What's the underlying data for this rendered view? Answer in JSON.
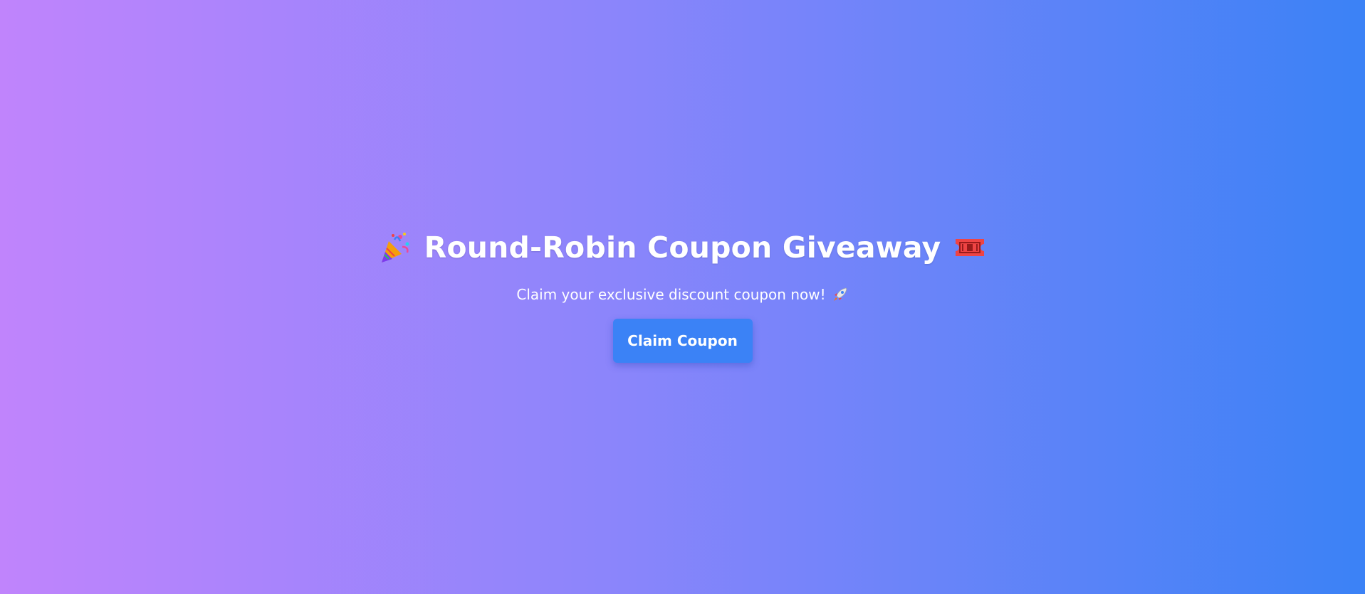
{
  "hero": {
    "title": "Round-Robin Coupon Giveaway",
    "title_icon_left": "party-popper-icon",
    "title_icon_right": "ticket-icon",
    "subtitle": "Claim your exclusive discount coupon now!",
    "subtitle_icon": "rocket-icon",
    "button_label": "Claim Coupon"
  },
  "colors": {
    "gradient_start": "#c084fc",
    "gradient_end": "#3b82f6",
    "button": "#3b82f6",
    "text": "#ffffff"
  }
}
